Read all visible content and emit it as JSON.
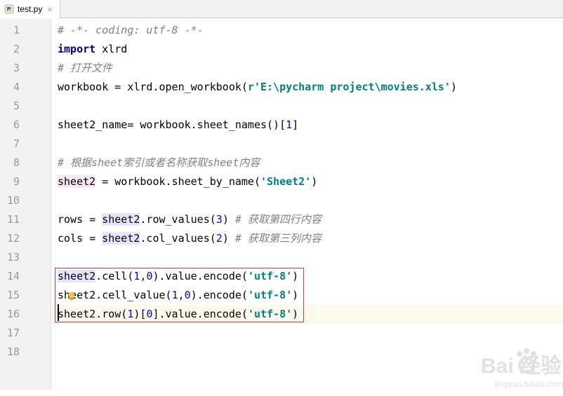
{
  "tab": {
    "filename": "test.py",
    "close_glyph": "×",
    "icon": "python-file-icon"
  },
  "gutter": {
    "line_numbers": [
      "1",
      "2",
      "3",
      "4",
      "5",
      "6",
      "7",
      "8",
      "9",
      "10",
      "11",
      "12",
      "13",
      "14",
      "15",
      "16",
      "17",
      "18"
    ]
  },
  "code": {
    "l1": "# -*- coding: utf-8 -*-",
    "l2_kw": "import",
    "l2_rest": " xlrd",
    "l3": "# 打开文件",
    "l4_a": "workbook = xlrd.open_workbook(",
    "l4_str": "r'E:\\pycharm project\\movies.xls'",
    "l4_b": ")",
    "l6_a": "sheet2_name= workbook.sheet_names()[",
    "l6_num": "1",
    "l6_b": "]",
    "l8": "# 根据sheet索引或者名称获取sheet内容",
    "l9_var": "sheet2",
    "l9_a": " = workbook.sheet_by_name(",
    "l9_str": "'Sheet2'",
    "l9_b": ")",
    "l11_a": "rows = ",
    "l11_var": "sheet2",
    "l11_b": ".row_values(",
    "l11_num": "3",
    "l11_c": ") ",
    "l11_cmt": "# 获取第四行内容",
    "l12_a": "cols = ",
    "l12_var": "sheet2",
    "l12_b": ".col_values(",
    "l12_num": "2",
    "l12_c": ") ",
    "l12_cmt": "# 获取第三列内容",
    "l14_var": "sheet2",
    "l14_a": ".cell(",
    "l14_n1": "1",
    "l14_sep": ",",
    "l14_n2": "0",
    "l14_b": ").value.encode(",
    "l14_str": "'utf-8'",
    "l14_c": ")",
    "l15_var": "sheet2",
    "l15_a": ".cell_value(",
    "l15_n1": "1",
    "l15_sep": ",",
    "l15_n2": "0",
    "l15_b": ").encode(",
    "l15_str": "'utf-8'",
    "l15_c": ")",
    "l16_var": "sheet2",
    "l16_a": ".row(",
    "l16_n1": "1",
    "l16_b": ")[",
    "l16_n2": "0",
    "l16_c": "].value.encode(",
    "l16_str": "'utf-8'",
    "l16_d": ")"
  },
  "watermark": {
    "brand": "Bai  经验",
    "url": "jingyan.baidu.com"
  },
  "colors": {
    "comment": "#808080",
    "keyword": "#000080",
    "string": "#008080",
    "number": "#0000ff",
    "selection_box": "#d9363e"
  }
}
